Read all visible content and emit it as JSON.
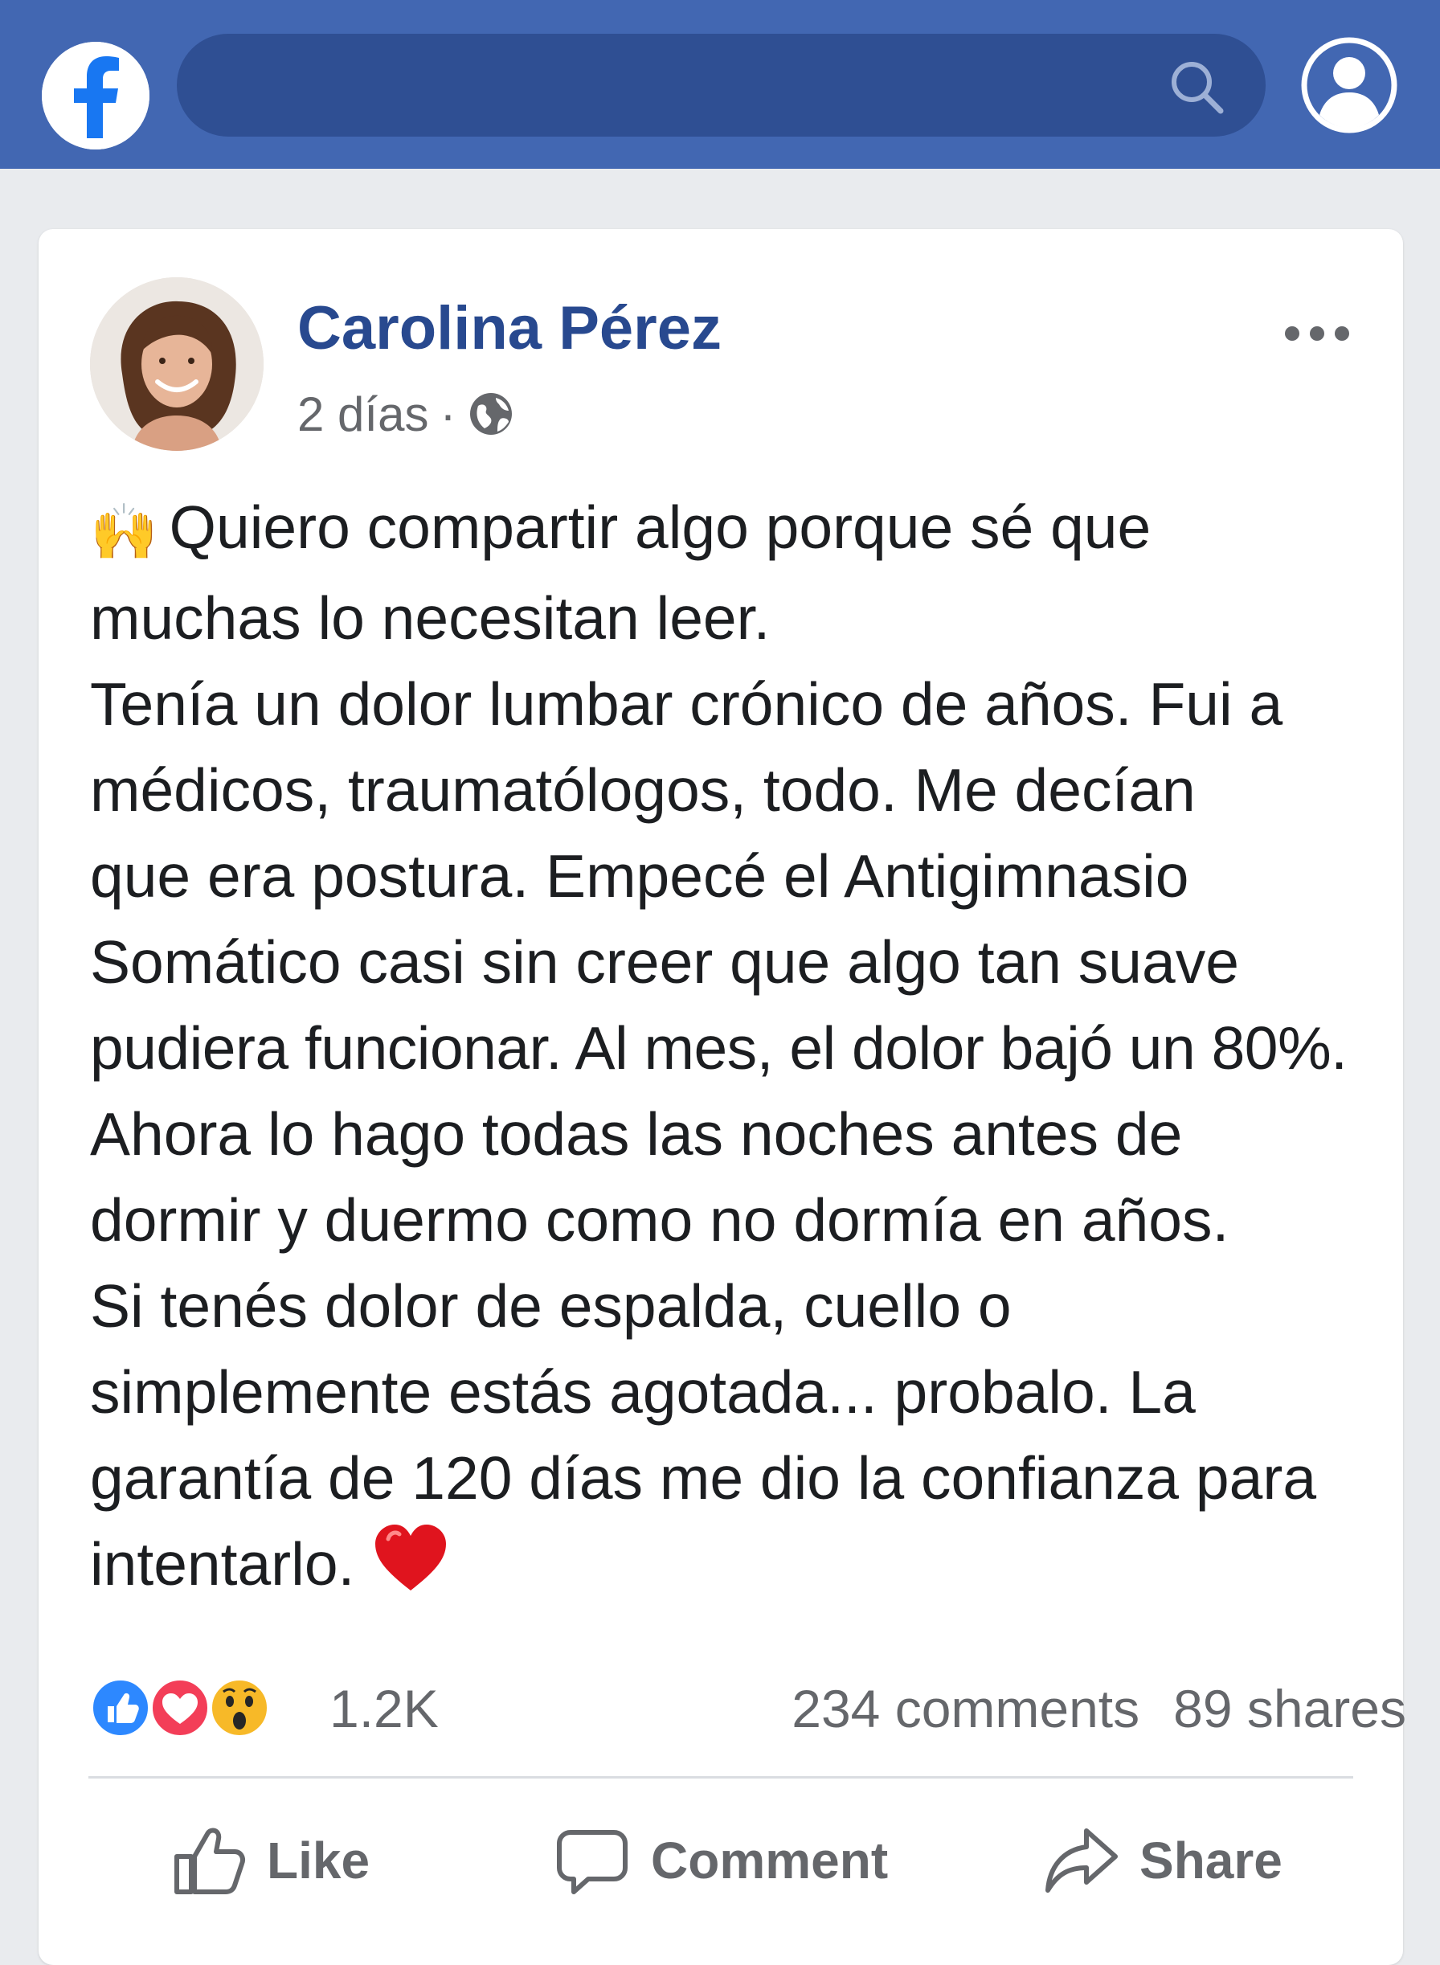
{
  "app": {
    "name": "Facebook",
    "brand_color": "#4267b2"
  },
  "topbar": {
    "logo_icon": "facebook-logo-icon",
    "search_icon": "search-icon",
    "profile_icon": "user-profile-icon"
  },
  "post": {
    "author": "Carolina Pérez",
    "time": "2 días",
    "separator": "·",
    "privacy_icon": "globe-icon",
    "menu_icon": "more-options-icon",
    "lines": [
      "Quiero compartir algo porque sé que",
      "muchas lo necesitan leer.",
      "Tenía un dolor lumbar crónico de años. Fui a",
      "médicos, traumatólogos, todo. Me decían",
      "que era postura. Empecé el Antigimnasio",
      "Somático casi sin creer que algo tan suave",
      "pudiera funcionar. Al mes, el dolor bajó un 80%.",
      "Ahora lo hago todas las noches antes de",
      "dormir y duermo como no dormía en años.",
      "Si tenés dolor de espalda, cuello o",
      "simplemente estás agotada... probalo. La",
      "garantía de 120 días me dio la confianza para",
      "intentarlo."
    ],
    "lead_emoji": "🙌",
    "end_emoji": "❤️"
  },
  "reactions": {
    "icons": [
      "like-reaction-icon",
      "love-reaction-icon",
      "wow-reaction-icon"
    ],
    "count": "1.2K",
    "comments": "234 comments",
    "shares": "89 shares"
  },
  "actions": {
    "like": "Like",
    "comment": "Comment",
    "share": "Share"
  }
}
